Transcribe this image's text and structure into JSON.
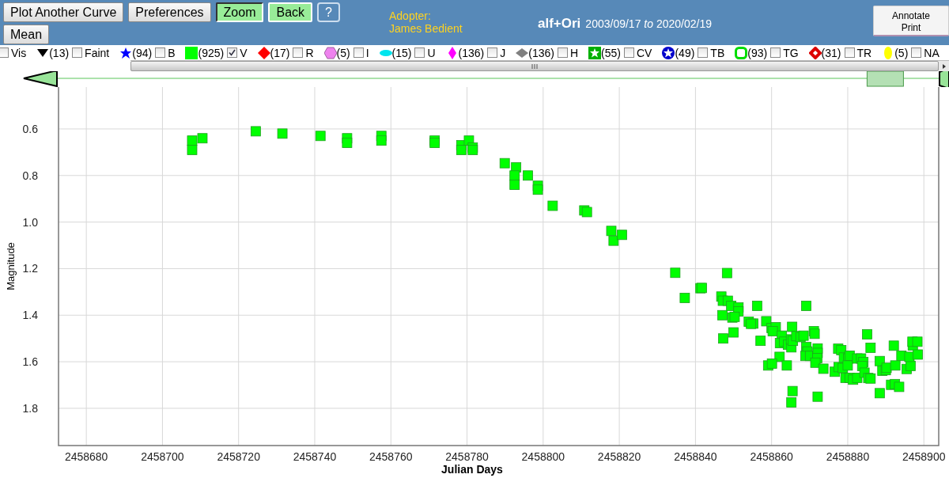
{
  "toolbar": {
    "buttons": [
      {
        "label": "Plot Another Curve",
        "kind": "grey"
      },
      {
        "label": "Preferences",
        "kind": "grey"
      },
      {
        "label": "Zoom",
        "kind": "green",
        "pressed": true
      },
      {
        "label": "Back",
        "kind": "green",
        "pressed": false
      },
      {
        "label": "?",
        "kind": "help"
      },
      {
        "label": "Mean",
        "kind": "grey"
      }
    ],
    "adopter_label": "Adopter:",
    "adopter_name": "James Bedient",
    "star": "alf+Ori",
    "date_range": "2003/09/17 *to* 2020/02/19",
    "annotate_button": [
      "Annotate",
      "Print"
    ]
  },
  "legend": [
    {
      "kind": "none",
      "label": "Vis",
      "checked": false
    },
    {
      "kind": "triangle",
      "color": "#000000",
      "count": "(13)",
      "label": "Faint",
      "checked": false
    },
    {
      "kind": "star",
      "color": "#0000ff",
      "count": "(94)",
      "label": "B",
      "checked": false
    },
    {
      "kind": "square",
      "color": "#00ff00",
      "count": "(925)",
      "label": "V",
      "checked": true
    },
    {
      "kind": "diamond",
      "color": "#ff0000",
      "count": "(17)",
      "label": "R",
      "checked": false
    },
    {
      "kind": "hexagon",
      "color": "#ee82ee",
      "count": "(5)",
      "label": "I",
      "checked": false
    },
    {
      "kind": "ellipse",
      "color": "#00e5ee",
      "count": "(15)",
      "label": "U",
      "checked": false
    },
    {
      "kind": "thin-diamond",
      "color": "#ff00ff",
      "count": "(136)",
      "label": "J",
      "checked": false
    },
    {
      "kind": "flat-diamond",
      "color": "#808080",
      "count": "(136)",
      "label": "H",
      "checked": false
    },
    {
      "kind": "star-square",
      "color": "#00b000",
      "count": "(55)",
      "label": "CV",
      "checked": false
    },
    {
      "kind": "star-circle",
      "color": "#0000cc",
      "count": "(49)",
      "label": "TB",
      "checked": false
    },
    {
      "kind": "ring-square",
      "color": "#00dd00",
      "count": "(93)",
      "label": "TG",
      "checked": false
    },
    {
      "kind": "ring-diamond",
      "color": "#dd0000",
      "count": "(31)",
      "label": "TR",
      "checked": false
    },
    {
      "kind": "oval",
      "color": "#ffff00",
      "count": "(5)",
      "label": "NA",
      "checked": false
    }
  ],
  "navigator": {
    "level": 0.96
  },
  "chart_data": {
    "type": "scatter",
    "grid": true,
    "xlabel": "Julian Days",
    "ylabel": "Magnitude",
    "xlim": [
      2458672.7,
      2458903.9
    ],
    "ylim": [
      1.96,
      0.42
    ],
    "xticks": [
      2458680,
      2458700,
      2458720,
      2458740,
      2458760,
      2458780,
      2458800,
      2458820,
      2458840,
      2458860,
      2458880,
      2458900
    ],
    "yticks": [
      {
        "value": 0.6,
        "label": "0.6"
      },
      {
        "value": 0.8,
        "label": "0.8"
      },
      {
        "value": 1.0,
        "label": "1.0"
      },
      {
        "value": 1.2,
        "label": "1.2"
      },
      {
        "value": 1.4,
        "label": "1.4"
      },
      {
        "value": 1.6,
        "label": "1.6"
      },
      {
        "value": 1.8,
        "label": "1.8"
      }
    ],
    "series": [
      {
        "color": "#00ff00",
        "x": [
          2458707.8,
          2458707.8,
          2458710.5,
          2458724.5,
          2458731.5,
          2458741.5,
          2458748.5,
          2458748.5,
          2458757.5,
          2458757.5,
          2458771.5,
          2458771.5,
          2458778.5,
          2458778.5,
          2458780.5,
          2458781.5,
          2458781.5,
          2458789.9,
          2458792.9,
          2458792.5,
          2458792.5,
          2458796.0,
          2458798.6,
          2458798.6,
          2458802.5,
          2458810.8,
          2458811.5,
          2458817.9,
          2458818.5,
          2458820.7,
          2458834.7,
          2458837.2,
          2458841.3,
          2458841.7,
          2458848.3,
          2458846.8,
          2458847.2,
          2458848.5,
          2458849.4,
          2458851.3,
          2458851.3,
          2458847.1,
          2458849.7,
          2458850.3,
          2458847.3,
          2458850.0,
          2458856.2,
          2458854.0,
          2458855.2,
          2458854.6,
          2458858.6,
          2458857.1,
          2458860.0,
          2458861.1,
          2458860.3,
          2458862.7,
          2458865.4,
          2458862.2,
          2458863.3,
          2458864.3,
          2458865.2,
          2458865.1,
          2458865.6,
          2458866.5,
          2458867.6,
          2458868.4,
          2458869.1,
          2458871.1,
          2458871.3,
          2458869.1,
          2458869.4,
          2458868.9,
          2458870.1,
          2458872.1,
          2458872.1,
          2458872.0,
          2458871.5,
          2458873.6,
          2458862.1,
          2458859.1,
          2458860.1,
          2458864.0,
          2458865.5,
          2458865.2,
          2458872.1,
          2458877.5,
          2458878.3,
          2458876.6,
          2458877.6,
          2458878.7,
          2458879.0,
          2458880.1,
          2458880.5,
          2458880.0,
          2458879.4,
          2458880.5,
          2458881.4,
          2458882.5,
          2458882.5,
          2458883.5,
          2458884.1,
          2458883.8,
          2458884.4,
          2458885.1,
          2458886.0,
          2458885.4,
          2458886.0,
          2458888.4,
          2458889.1,
          2458890.0,
          2458888.4,
          2458890.2,
          2458892.1,
          2458892.5,
          2458891.4,
          2458892.4,
          2458893.5,
          2458894.1,
          2458895.5,
          2458896.5,
          2458896.2,
          2458897.1,
          2458897.0,
          2458898.3,
          2458898.4
        ],
        "values": [
          0.65,
          0.69,
          0.64,
          0.61,
          0.62,
          0.63,
          0.64,
          0.66,
          0.63,
          0.65,
          0.65,
          0.66,
          0.67,
          0.69,
          0.65,
          0.68,
          0.69,
          0.747,
          0.765,
          0.8,
          0.84,
          0.8,
          0.844,
          0.861,
          0.93,
          0.95,
          0.957,
          1.038,
          1.08,
          1.055,
          1.218,
          1.326,
          1.284,
          1.283,
          1.219,
          1.32,
          1.338,
          1.338,
          1.36,
          1.367,
          1.384,
          1.4,
          1.41,
          1.407,
          1.5,
          1.474,
          1.36,
          1.428,
          1.436,
          1.437,
          1.426,
          1.51,
          1.455,
          1.452,
          1.469,
          1.488,
          1.45,
          1.52,
          1.514,
          1.527,
          1.538,
          1.504,
          1.51,
          1.49,
          1.494,
          1.488,
          1.36,
          1.469,
          1.48,
          1.537,
          1.556,
          1.575,
          1.575,
          1.543,
          1.562,
          1.584,
          1.604,
          1.63,
          1.579,
          1.616,
          1.608,
          1.616,
          1.726,
          1.775,
          1.75,
          1.544,
          1.55,
          1.643,
          1.623,
          1.627,
          1.582,
          1.586,
          1.574,
          1.616,
          1.669,
          1.669,
          1.677,
          1.669,
          1.586,
          1.586,
          1.601,
          1.618,
          1.647,
          1.482,
          1.54,
          1.67,
          1.672,
          1.597,
          1.639,
          1.636,
          1.735,
          1.626,
          1.531,
          1.616,
          1.699,
          1.696,
          1.708,
          1.574,
          1.631,
          1.618,
          1.579,
          1.53,
          1.514,
          1.514,
          1.569
        ]
      }
    ]
  }
}
